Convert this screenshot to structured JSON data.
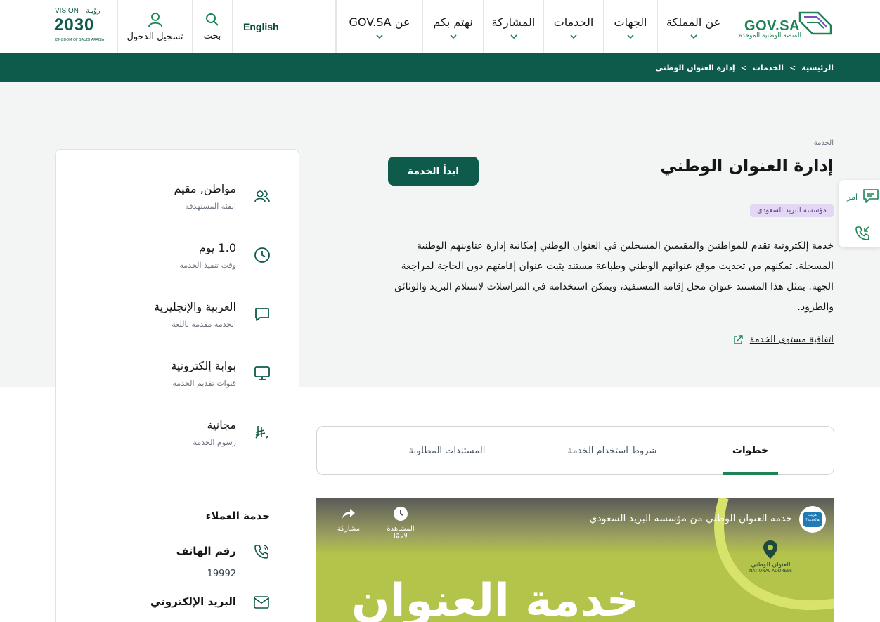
{
  "header": {
    "logo_text": "GOV.SA",
    "logo_subtitle": "المنصة الوطنية الموحدة",
    "nav": [
      {
        "label": "عن المملكة"
      },
      {
        "label": "الجهات"
      },
      {
        "label": "الخدمات"
      },
      {
        "label": "المشاركة"
      },
      {
        "label": "نهتم بكم"
      },
      {
        "label": "عن GOV.SA"
      }
    ],
    "language_label": "English",
    "search_label": "بحث",
    "login_label": "تسجيل الدخول",
    "vision_text": "VISION",
    "vision_arabic": "رؤيـة",
    "vision_year": "2030",
    "vision_kingdom": "KINGDOM OF SAUDI ARABIA"
  },
  "breadcrumb": {
    "home": "الرئيسية",
    "services": "الخدمات",
    "current": "إدارة العنوان الوطني",
    "separator": ">"
  },
  "service": {
    "eyebrow": "الخدمة",
    "title": "إدارة العنوان الوطني",
    "start_button": "ابدأ الخدمة",
    "agency_badge": "مؤسسة البريد السعودي",
    "description": "خدمة إلكترونية تقدم للمواطنين والمقيمين المسجلين في العنوان الوطني إمكانية إدارة عناوينهم الوطنية المسجلة. تمكنهم من تحديث موقع عنوانهم الوطني وطباعة مستند يثبت عنوان إقامتهم دون الحاجة لمراجعة الجهة. يمثل هذا المستند عنوان محل إقامة المستفيد، ويمكن استخدامه في المراسلات لاستلام البريد والوثائق والطرود.",
    "sla_link": "اتفاقية مستوى الخدمة"
  },
  "info": [
    {
      "value": "مواطن, مقيم",
      "label": "الفئة المستهدفة",
      "icon": "users-icon"
    },
    {
      "value": "1.0 يوم",
      "label": "وقت تنفيذ الخدمة",
      "icon": "clock-icon"
    },
    {
      "value": "العربية والإنجليزية",
      "label": "الخدمة مقدمة باللغة",
      "icon": "chat-icon"
    },
    {
      "value": "بوابة إلكترونية",
      "label": "قنوات تقديم الخدمة",
      "icon": "monitor-icon"
    },
    {
      "value": "مجانية",
      "label": "رسوم الخدمة",
      "icon": "riyal-icon"
    }
  ],
  "customer_service": {
    "title": "خدمة العملاء",
    "phone_label": "رقم الهاتف",
    "phone_value": "19992",
    "email_label": "البريد الإلكتروني"
  },
  "tabs": [
    {
      "label": "خطوات",
      "active": true
    },
    {
      "label": "شروط استخدام الخدمة",
      "active": false
    },
    {
      "label": "المستندات المطلوبة",
      "active": false
    }
  ],
  "video": {
    "title": "خدمة العنوان الوطني من مؤسسة البريد السعودي",
    "watch_later": "المشاهدة لاحقًا",
    "share": "مشاركة",
    "big_text": "خدمة العنوان",
    "channel_badge": "تعريبك هالخدمة؟",
    "watermark_ar": "العنوان الوطني",
    "watermark_en": "NATIONAL ADDRESS"
  },
  "float_tools": {
    "amr_label": "آمر"
  },
  "colors": {
    "primary": "#0e5a4b",
    "accent": "#1b8354",
    "badge_bg": "#e3d8f3",
    "hero_bg": "#f3f5f4"
  }
}
